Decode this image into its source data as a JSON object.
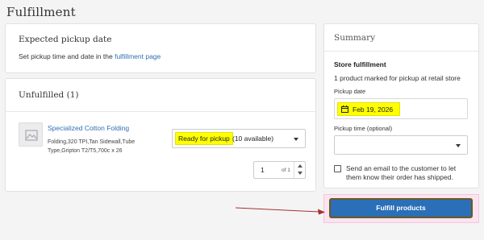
{
  "page": {
    "title": "Fulfillment"
  },
  "pickup": {
    "title": "Expected pickup date",
    "text_prefix": "Set pickup time and date in the ",
    "link": "fulfillment page"
  },
  "unfulfilled": {
    "title": "Unfulfilled (1)",
    "product": {
      "name": "Specialized Cotton Folding",
      "desc": "Folding,320 TPI,Tan Sidewall,Tube Type,Gripton T2/T5,700c x 26"
    },
    "status": {
      "selected": "Ready for pickup",
      "available": "(10 available)"
    },
    "quantity": {
      "value": "1",
      "of": "of 1"
    }
  },
  "summary": {
    "title": "Summary",
    "subtitle": "Store fulfillment",
    "text": "1 product marked for pickup at retail store",
    "pickup_date_label": "Pickup date",
    "pickup_date_value": "Feb 19, 2026",
    "pickup_time_label": "Pickup time (optional)",
    "pickup_time_value": "",
    "email_label": "Send an email to the customer to let them know their order has shipped."
  },
  "actions": {
    "fulfill": "Fulfill products"
  },
  "colors": {
    "accent": "#2a6fb8",
    "highlight": "#ffff00",
    "link": "#2f6fb5"
  }
}
